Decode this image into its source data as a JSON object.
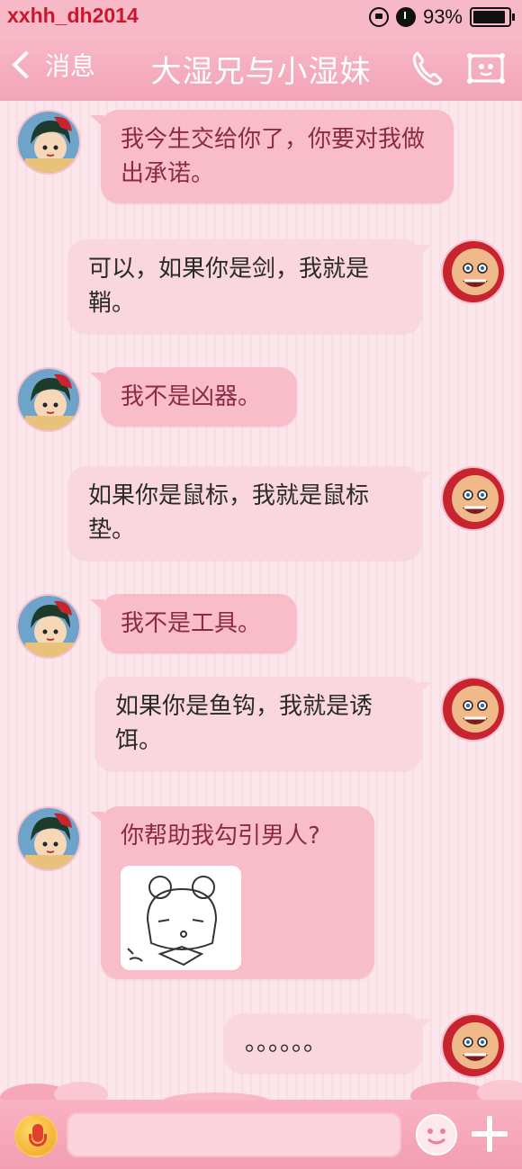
{
  "status_bar": {
    "watermark": "xxhh_dh2014",
    "battery_percent": "93%",
    "battery_level": 0.93,
    "icons": [
      "rotation-lock-icon",
      "alarm-icon",
      "battery-icon"
    ]
  },
  "nav": {
    "back_label": "消息",
    "title": "大湿兄与小湿妹",
    "icons": [
      "chevron-left-icon",
      "phone-icon",
      "profile-card-icon"
    ]
  },
  "messages": [
    {
      "side": "left",
      "text": "我今生交给你了，你要对我做出承诺。"
    },
    {
      "side": "right",
      "text": "可以，如果你是剑，我就是鞘。"
    },
    {
      "side": "left",
      "text": "我不是凶器。"
    },
    {
      "side": "right",
      "text": "如果你是鼠标，我就是鼠标垫。"
    },
    {
      "side": "left",
      "text": "我不是工具。"
    },
    {
      "side": "right",
      "text": "如果你是鱼钩，我就是诱饵。"
    },
    {
      "side": "left",
      "text": "你帮助我勾引男人?",
      "has_sticker": true
    },
    {
      "side": "right",
      "text": "。。。。。。"
    }
  ],
  "input_bar": {
    "icons": [
      "microphone-icon",
      "emoji-icon",
      "plus-icon"
    ]
  },
  "colors": {
    "header": "#f7b9c8",
    "left_bubble": "#f9bdc9",
    "right_bubble": "#fad7df",
    "left_text": "#8a2b43",
    "watermark": "#c9182b"
  }
}
